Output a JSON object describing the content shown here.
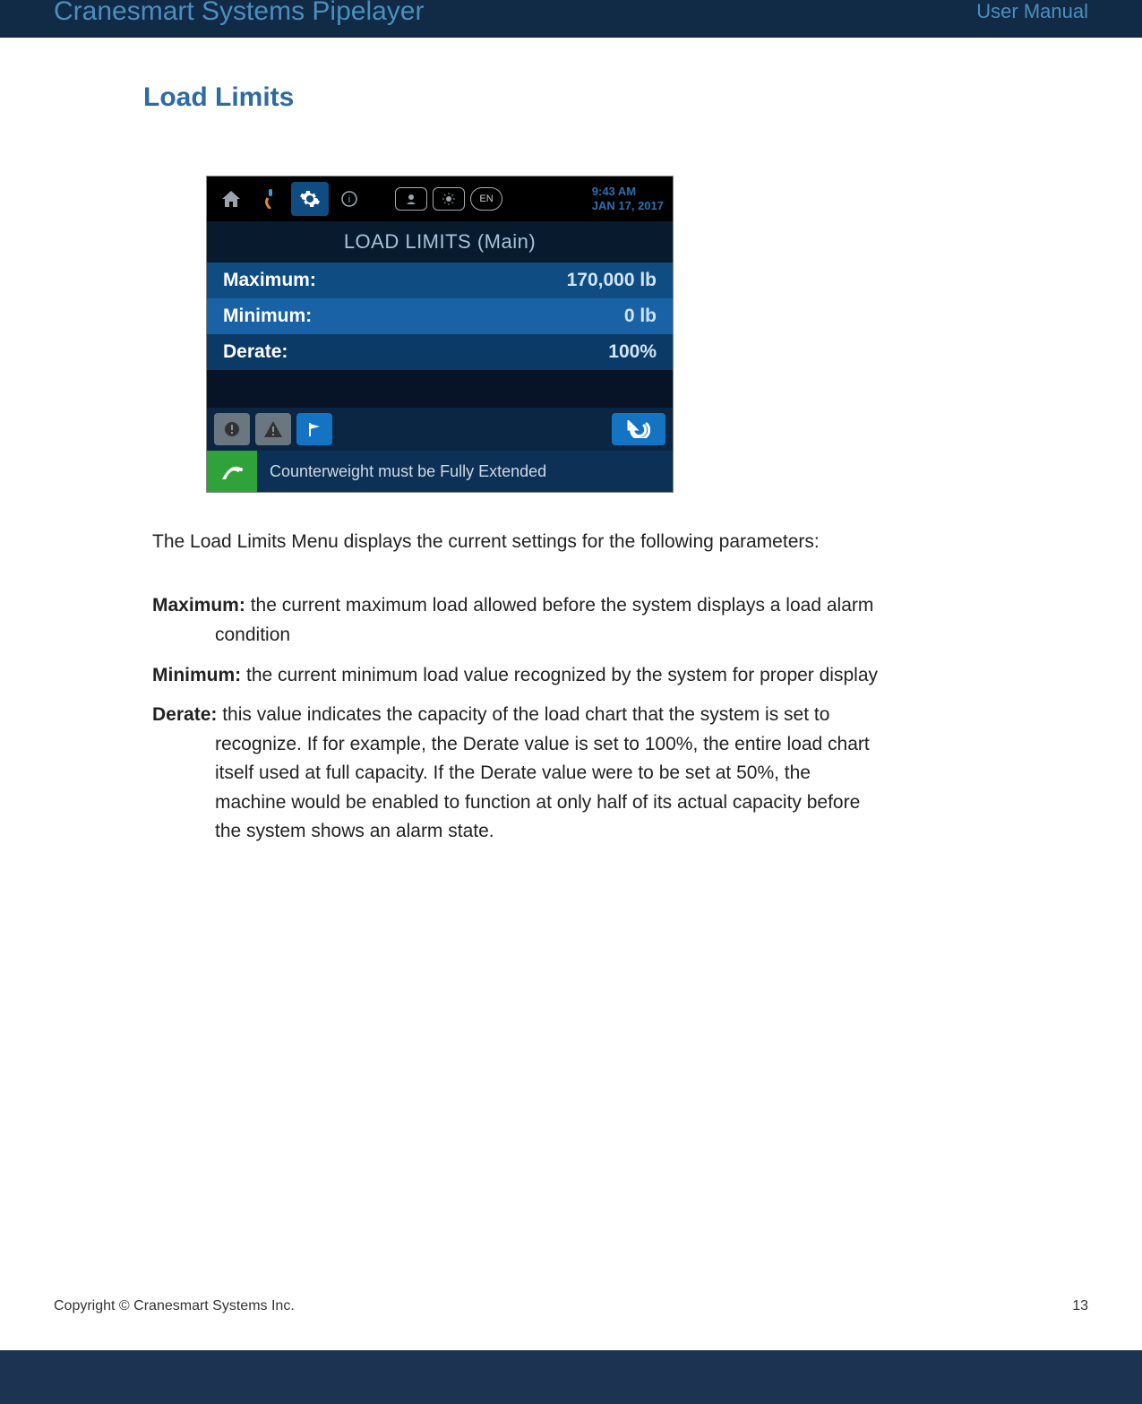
{
  "header": {
    "title_left": "Cranesmart Systems Pipelayer",
    "title_right": "User Manual"
  },
  "section": {
    "heading": "Load Limits"
  },
  "screen": {
    "time": "9:43 AM",
    "date": "JAN 17, 2017",
    "title": "LOAD LIMITS (Main)",
    "lang_badge": "EN",
    "rows": {
      "max_label": "Maximum:",
      "max_value": "170,000 lb",
      "min_label": "Minimum:",
      "min_value": "0 lb",
      "der_label": "Derate:",
      "der_value": "100%"
    },
    "message": "Counterweight must be Fully Extended"
  },
  "paragraph": "The Load Limits Menu displays the current settings for the following parameters:",
  "definitions": {
    "max_label": "Maximum:",
    "max_text_line1": " the current maximum load allowed before the system displays a load alarm",
    "max_text_line2": "condition",
    "min_label": "Minimum:",
    "min_text": "  the current minimum load value recognized by the system for proper display",
    "der_label": "Derate:",
    "der_text_line1": "  this value indicates the capacity of the load chart that the system is set to",
    "der_text_line2": "recognize.  If for example, the Derate value is set to 100%, the entire load chart",
    "der_text_line3": "itself used at full capacity.  If the Derate value were to be set at 50%, the",
    "der_text_line4": "machine would be enabled to function at only half of its actual capacity before",
    "der_text_line5": "the system shows an alarm state."
  },
  "footer": {
    "copyright": "Copyright © Cranesmart Systems Inc.",
    "page_number": "13"
  }
}
